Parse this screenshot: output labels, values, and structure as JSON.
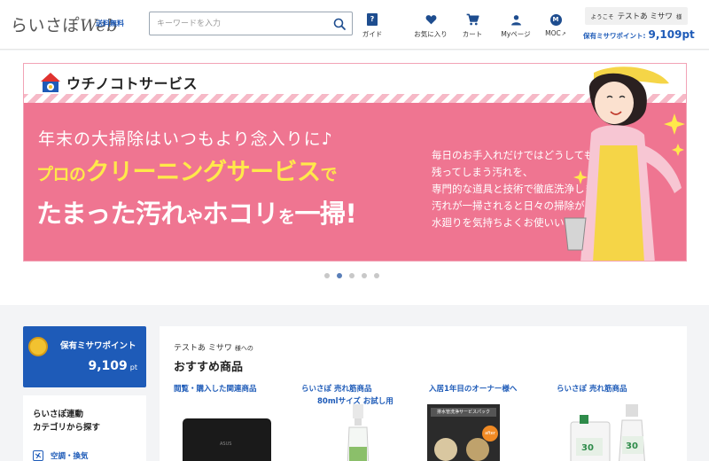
{
  "header": {
    "logo_main": "らいさぽ",
    "logo_web": "Web",
    "free_shipping": "送料無料",
    "search_placeholder": "キーワードを入力",
    "nav": {
      "guide": "ガイド",
      "favorites": "お気に入り",
      "cart": "カート",
      "mypage": "Myページ",
      "moc": "MOC"
    },
    "welcome_prefix": "ようこそ",
    "user_name": "テストあ ミサワ",
    "welcome_suffix": "様",
    "points_label": "保有ミサワポイント:",
    "points_value": "9,109pt"
  },
  "banner": {
    "brand": "ウチノコトサービス",
    "line1": "年末の大掃除はいつもより念入りに♪",
    "line2_a": "プロの",
    "line2_b": "クリーニングサービス",
    "line2_c": "で",
    "line3_a": "たまった汚れ",
    "line3_b": "や",
    "line3_c": "ホコリ",
    "line3_d": "を",
    "line3_e": "一掃!",
    "desc": [
      "毎日のお手入れだけではどうしても",
      "残ってしまう汚れを、",
      "専門的な道具と技術で徹底洗浄しませんか？",
      "汚れが一掃されると日々の掃除がしやすくなり、",
      "水廻りを気持ちよくお使いいただけます。"
    ],
    "active_dot": 1
  },
  "sidebar": {
    "points_title": "保有ミサワポイント",
    "points_value": "9,109",
    "points_unit": "pt",
    "category_title_1": "らいさぽ連動",
    "category_title_2": "カテゴリから探す",
    "category_first": "空調・換気"
  },
  "recommend": {
    "for_user": "テストあ ミサワ",
    "for_suffix": "様への",
    "title": "おすすめ商品",
    "columns": [
      "閲覧・購入した関連商品",
      "らいさぽ 売れ筋商品",
      "入居1年目のオーナー様へ",
      "らいさぽ 売れ筋商品"
    ],
    "col2_sub": "80mlサイズ お試し用",
    "pack_label": "排水管洗浄サービスパック",
    "after_label": "after",
    "laptop_label": "ASUS",
    "bottle_num": "30"
  }
}
